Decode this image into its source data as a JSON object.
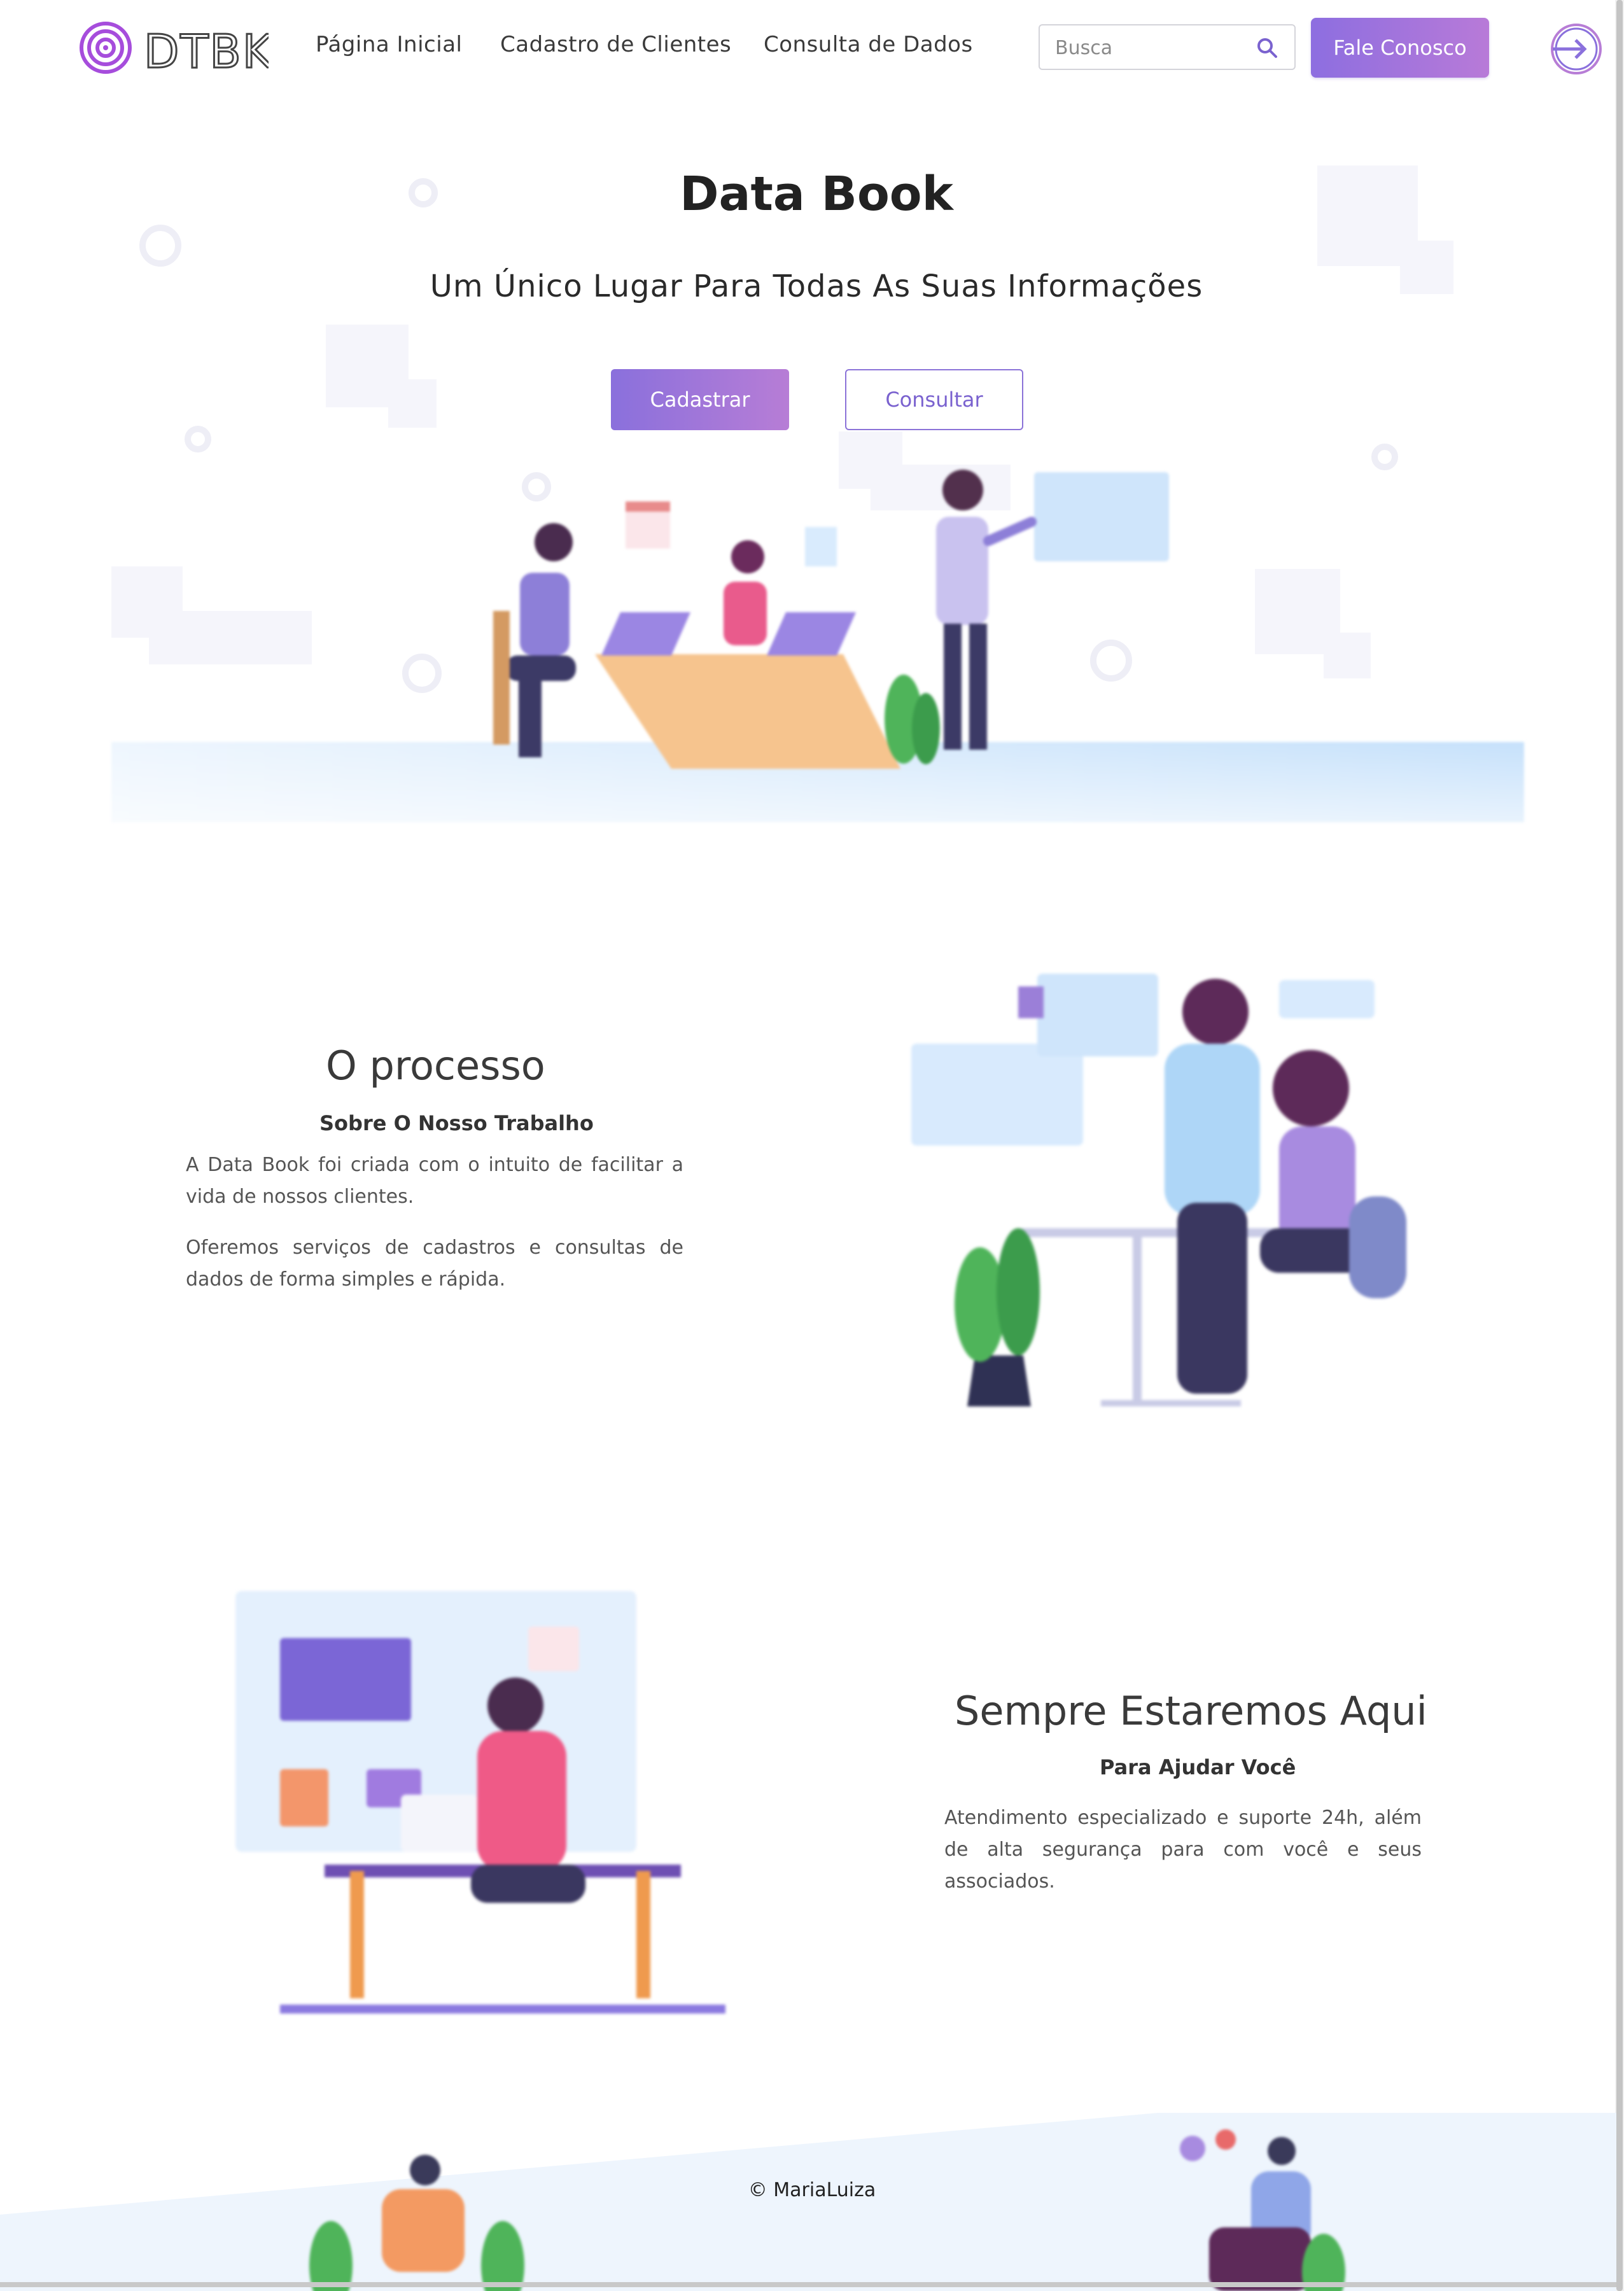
{
  "header": {
    "logo_alt": "DTBK",
    "nav": [
      {
        "label": "Página Inicial"
      },
      {
        "label": "Cadastro de Clientes"
      },
      {
        "label": "Consulta de Dados"
      }
    ],
    "search": {
      "placeholder": "Busca",
      "icon": "search-icon"
    },
    "contact_label": "Fale Conosco",
    "login_icon": "login-arrow-icon"
  },
  "hero": {
    "title": "Data Book",
    "subtitle": "Um Único Lugar Para Todas As Suas Informações",
    "primary_label": "Cadastrar",
    "secondary_label": "Consultar"
  },
  "process": {
    "title": "O processo",
    "subtitle": "Sobre O Nosso Trabalho",
    "paragraphs": [
      "A Data Book foi criada com o intuito de facilitar a vida de nossos clientes.",
      "Oferemos serviços de cadastros e consultas de dados de forma simples e rápida."
    ]
  },
  "support": {
    "title": "Sempre Estaremos Aqui",
    "subtitle": "Para Ajudar Você",
    "paragraph": "Atendimento especializado e suporte 24h, além de alta segurança para com você e seus associados."
  },
  "footer": {
    "copyright": "© MariaLuiza"
  },
  "colors": {
    "accent": "#8a70dc",
    "accent_end": "#b77dd6",
    "hero_floor": "#cfe5fb"
  }
}
